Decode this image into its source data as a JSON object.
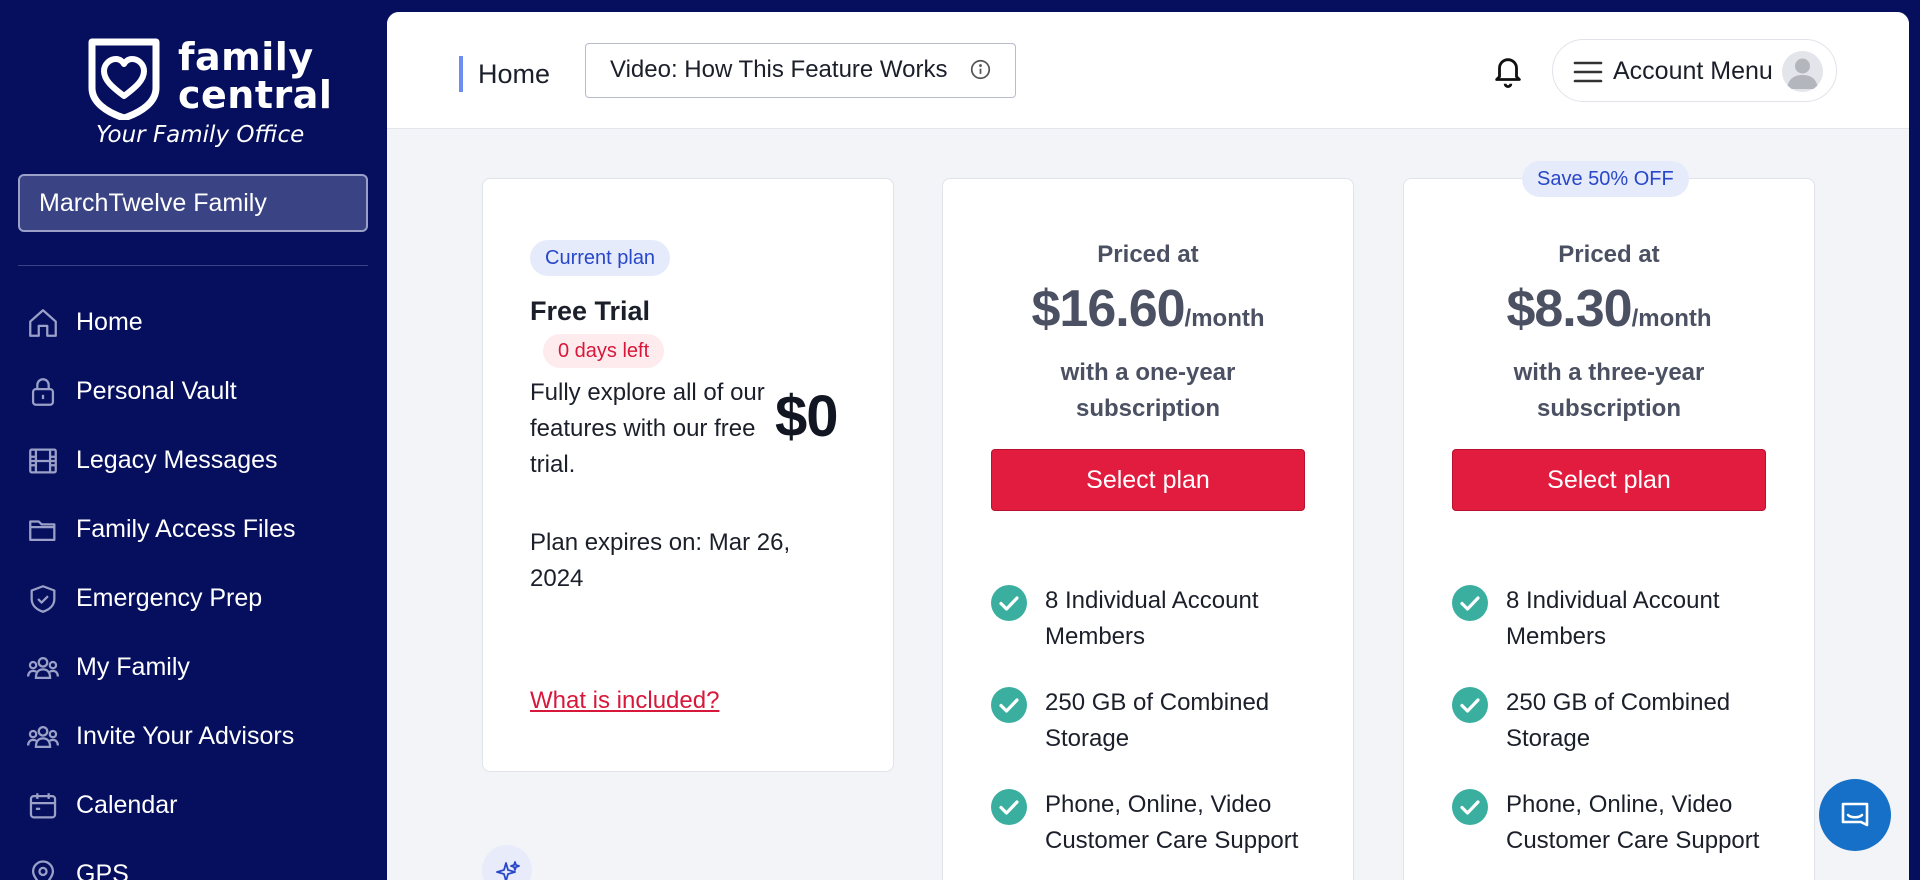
{
  "brand": {
    "line1": "family",
    "line2": "central",
    "tagline": "Your Family Office"
  },
  "family_selector": {
    "value": "MarchTwelve Family"
  },
  "sidebar": {
    "items": [
      {
        "label": "Home",
        "icon": "home-icon"
      },
      {
        "label": "Personal Vault",
        "icon": "lock-icon"
      },
      {
        "label": "Legacy Messages",
        "icon": "film-icon"
      },
      {
        "label": "Family Access Files",
        "icon": "folder-icon"
      },
      {
        "label": "Emergency Prep",
        "icon": "shield-icon"
      },
      {
        "label": "My Family",
        "icon": "users-icon"
      },
      {
        "label": "Invite Your Advisors",
        "icon": "users-icon"
      },
      {
        "label": "Calendar",
        "icon": "calendar-icon"
      },
      {
        "label": "GPS",
        "icon": "map-pin-icon"
      }
    ]
  },
  "header": {
    "breadcrumb": "Home",
    "video_button": "Video: How This Feature Works",
    "account_menu": "Account Menu"
  },
  "plans": {
    "current": {
      "badge": "Current plan",
      "name": "Free Trial",
      "days_left": "0 days left",
      "description": "Fully explore all of our features with our free trial.",
      "price": "$0",
      "expires": "Plan expires on: Mar 26, 2024",
      "included_link": "What is included?"
    },
    "one_year": {
      "priced_label": "Priced at",
      "price": "$16.60",
      "unit": "/month",
      "subscription": "with a one-year subscription",
      "button": "Select plan",
      "features": [
        "8 Individual Account Members",
        "250 GB of Combined Storage",
        "Phone, Online, Video Customer Care Support"
      ]
    },
    "three_year": {
      "badge": "Save 50% OFF",
      "priced_label": "Priced at",
      "price": "$8.30",
      "unit": "/month",
      "subscription": "with a three-year subscription",
      "button": "Select plan",
      "features": [
        "8 Individual Account Members",
        "250 GB of Combined Storage",
        "Phone, Online, Video Customer Care Support"
      ]
    }
  },
  "colors": {
    "sidebar_bg": "#060F5E",
    "accent_red": "#E21C3E",
    "check_teal": "#3AAFA0",
    "badge_blue": "#2847C9",
    "chat_blue": "#1670C7"
  }
}
